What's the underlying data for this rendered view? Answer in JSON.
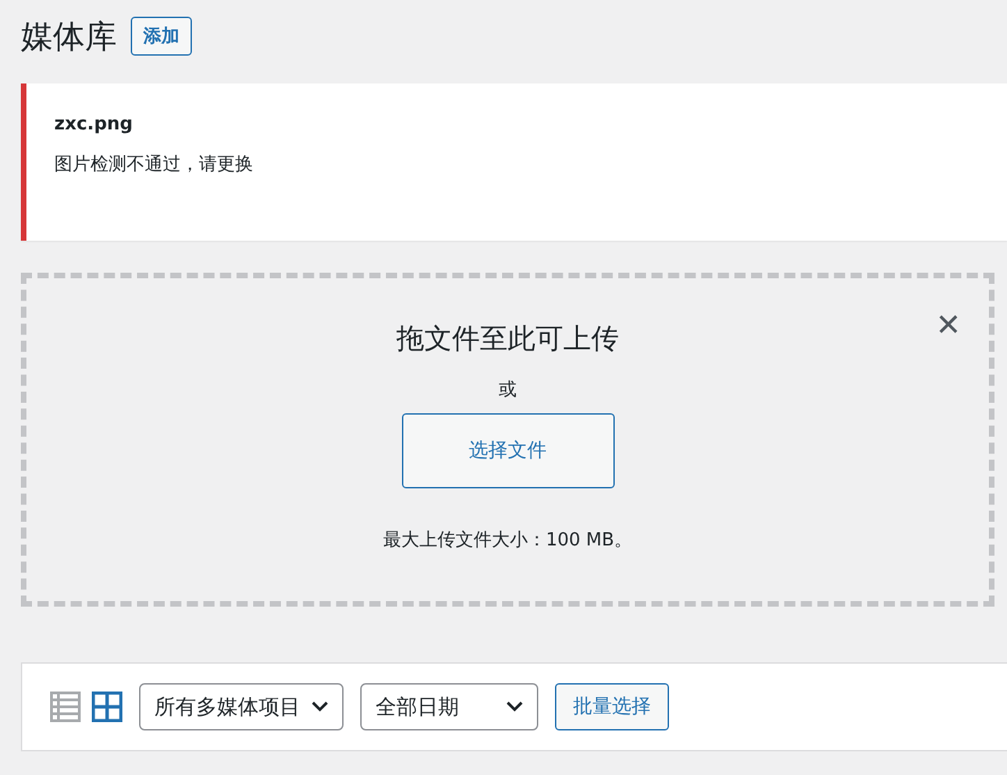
{
  "header": {
    "title": "媒体库",
    "add_button": "添加"
  },
  "notice": {
    "filename": "zxc.png",
    "message": "图片检测不通过，请更换"
  },
  "uploader": {
    "close": "✕",
    "title": "拖文件至此可上传",
    "or": "或",
    "select_button": "选择文件",
    "max_size": "最大上传文件大小：100 MB。"
  },
  "toolbar": {
    "view_modes": [
      {
        "kind": "list",
        "selected": false
      },
      {
        "kind": "grid",
        "selected": true
      }
    ],
    "filters": [
      "所有多媒体项目",
      "全部日期"
    ],
    "bulk_button": "批量选择"
  }
}
